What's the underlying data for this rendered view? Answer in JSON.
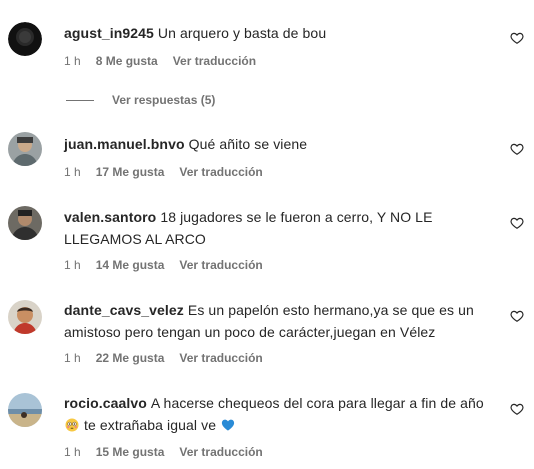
{
  "comments": [
    {
      "username": "agust_in9245",
      "text": "Un arquero y basta de bou",
      "time": "1 h",
      "likes": "8 Me gusta",
      "translate": "Ver traducción",
      "replies": "Ver respuestas (5)"
    },
    {
      "username": "juan.manuel.bnvo",
      "text": "Qué añito se viene",
      "time": "1 h",
      "likes": "17 Me gusta",
      "translate": "Ver traducción"
    },
    {
      "username": "valen.santoro",
      "text": "18 jugadores se le fueron a cerro, Y NO LE LLEGAMOS AL ARCO",
      "time": "1 h",
      "likes": "14 Me gusta",
      "translate": "Ver traducción"
    },
    {
      "username": "dante_cavs_velez",
      "text": "Es un papelón esto hermano,ya se que es un amistoso pero tengan un poco de carácter,juegan en Vélez",
      "time": "1 h",
      "likes": "22 Me gusta",
      "translate": "Ver traducción"
    },
    {
      "username": "rocio.caalvo",
      "text": "A hacerse chequeos del cora para llegar a fin de año",
      "text_after_emoji": "te extrañaba igual ve",
      "emojis": [
        "flushed-face-emoji",
        "blue-heart-emoji"
      ],
      "time": "1 h",
      "likes": "15 Me gusta",
      "translate": "Ver traducción"
    }
  ]
}
